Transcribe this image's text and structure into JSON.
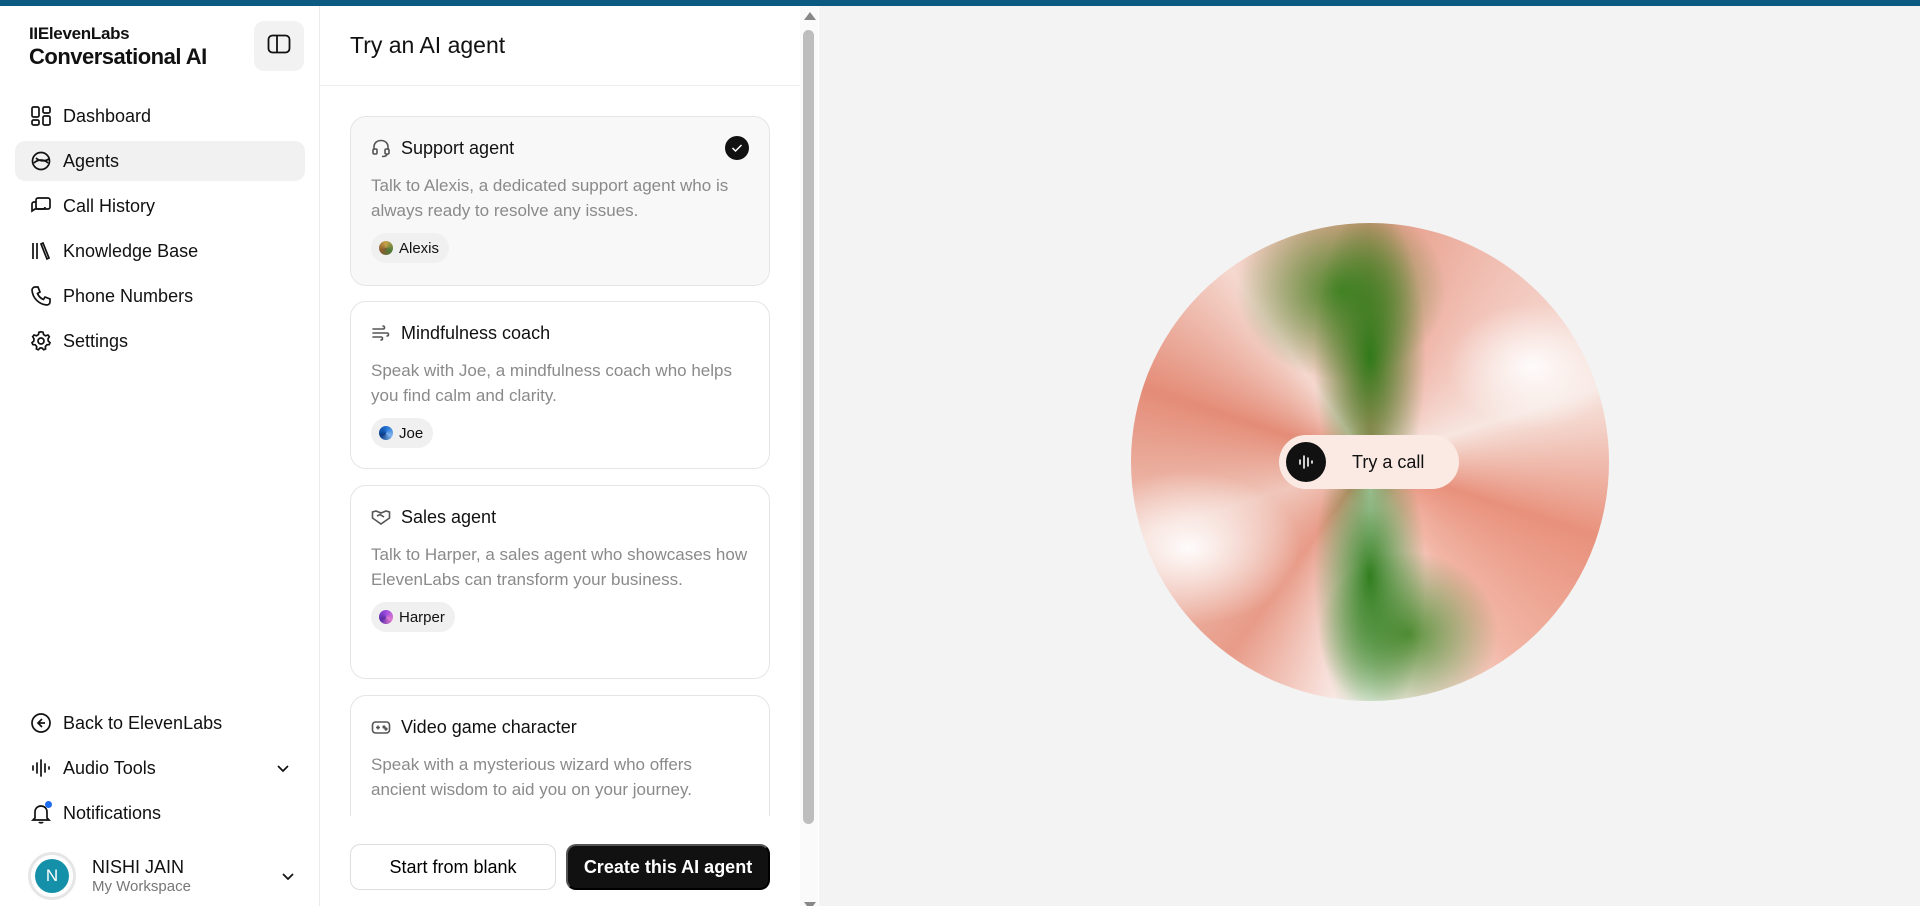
{
  "brand": {
    "top": "IIElevenLabs",
    "bottom": "Conversational AI"
  },
  "sidebar": {
    "items": [
      {
        "label": "Dashboard",
        "icon": "dashboard-icon",
        "active": false
      },
      {
        "label": "Agents",
        "icon": "agents-icon",
        "active": true
      },
      {
        "label": "Call History",
        "icon": "call-history-icon",
        "active": false
      },
      {
        "label": "Knowledge Base",
        "icon": "knowledge-base-icon",
        "active": false
      },
      {
        "label": "Phone Numbers",
        "icon": "phone-icon",
        "active": false
      },
      {
        "label": "Settings",
        "icon": "gear-icon",
        "active": false
      }
    ],
    "bottom": {
      "back": "Back to ElevenLabs",
      "audio_tools": "Audio Tools",
      "notifications": "Notifications"
    },
    "user": {
      "initial": "N",
      "name": "NISHI JAIN",
      "workspace": "My Workspace"
    }
  },
  "panel": {
    "title": "Try an AI agent",
    "cards": [
      {
        "title": "Support agent",
        "desc": "Talk to Alexis, a dedicated support agent who is always ready to resolve any issues.",
        "voice": "Alexis",
        "selected": true
      },
      {
        "title": "Mindfulness coach",
        "desc": "Speak with Joe, a mindfulness coach who helps you find calm and clarity.",
        "voice": "Joe",
        "selected": false
      },
      {
        "title": "Sales agent",
        "desc": "Talk to Harper, a sales agent who showcases how ElevenLabs can transform your business.",
        "voice": "Harper",
        "selected": false
      },
      {
        "title": "Video game character",
        "desc": "Speak with a mysterious wizard who offers ancient wisdom to aid you on your journey.",
        "voice": "",
        "selected": false
      }
    ],
    "start_blank": "Start from blank",
    "create_agent": "Create this AI agent"
  },
  "stage": {
    "try_call": "Try a call"
  },
  "colors": {
    "accent": "#111111",
    "topbar": "#0b5a82",
    "avatar": "#1490a8",
    "notification_dot": "#1d6cf0"
  }
}
